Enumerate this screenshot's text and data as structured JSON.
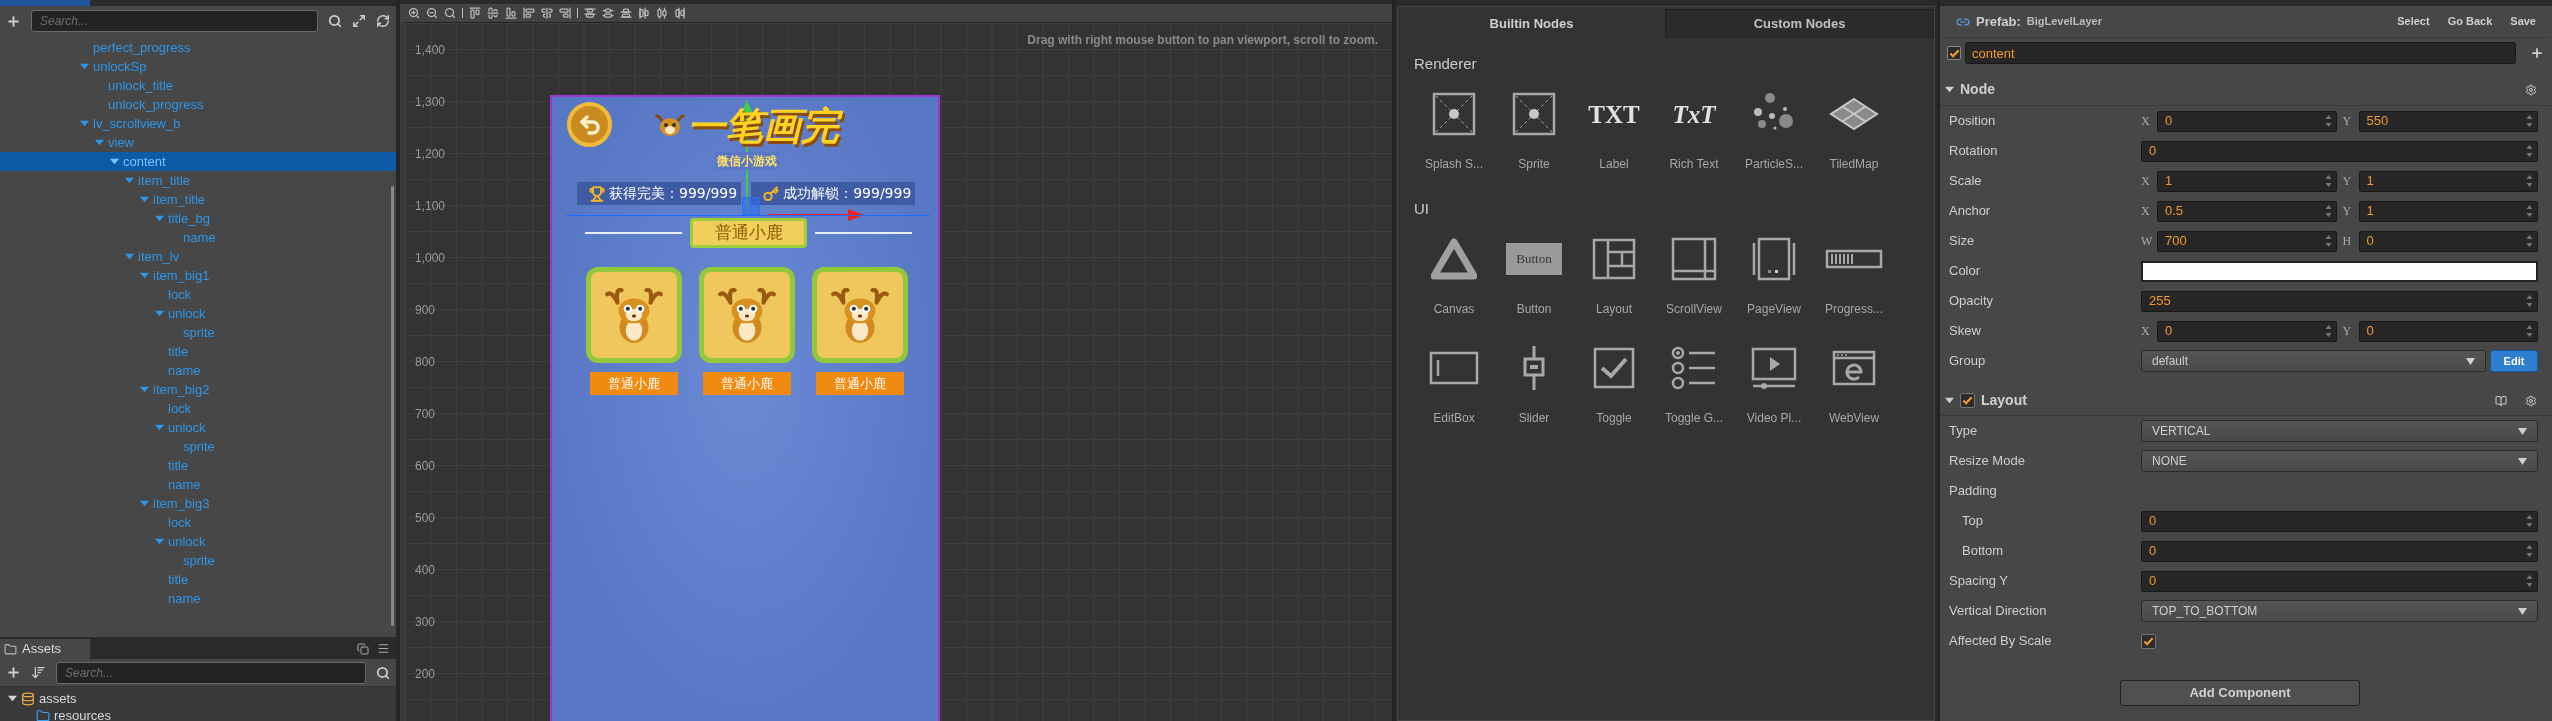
{
  "hierarchy": {
    "search": {
      "placeholder": "Search..."
    },
    "tree": [
      {
        "label": "perfect_progress",
        "selected": false
      },
      {
        "label": "unlockSp",
        "expanded": true,
        "selected": false,
        "children": [
          {
            "label": "unlock_title",
            "selected": false
          },
          {
            "label": "unlock_progress",
            "selected": false
          }
        ]
      },
      {
        "label": "lv_scrollview_b",
        "expanded": true,
        "selected": false,
        "children": [
          {
            "label": "view",
            "expanded": true,
            "selected": false,
            "children": [
              {
                "label": "content",
                "expanded": true,
                "selected": true,
                "children": [
                  {
                    "label": "item_title",
                    "expanded": true,
                    "selected": false,
                    "children": [
                      {
                        "label": "item_title",
                        "expanded": true,
                        "selected": false,
                        "children": [
                          {
                            "label": "title_bg",
                            "expanded": true,
                            "selected": false,
                            "children": [
                              {
                                "label": "name",
                                "selected": false
                              }
                            ]
                          }
                        ]
                      }
                    ]
                  },
                  {
                    "label": "item_lv",
                    "expanded": true,
                    "selected": false,
                    "children": [
                      {
                        "label": "item_big1",
                        "expanded": true,
                        "selected": false,
                        "children": [
                          {
                            "label": "lock",
                            "selected": false
                          },
                          {
                            "label": "unlock",
                            "expanded": true,
                            "selected": false,
                            "children": [
                              {
                                "label": "sprite",
                                "selected": false
                              }
                            ]
                          },
                          {
                            "label": "title",
                            "selected": false
                          },
                          {
                            "label": "name",
                            "selected": false
                          }
                        ]
                      },
                      {
                        "label": "item_big2",
                        "expanded": true,
                        "selected": false,
                        "children": [
                          {
                            "label": "lock",
                            "selected": false
                          },
                          {
                            "label": "unlock",
                            "expanded": true,
                            "selected": false,
                            "children": [
                              {
                                "label": "sprite",
                                "selected": false
                              }
                            ]
                          },
                          {
                            "label": "title",
                            "selected": false
                          },
                          {
                            "label": "name",
                            "selected": false
                          }
                        ]
                      },
                      {
                        "label": "item_big3",
                        "expanded": true,
                        "selected": false,
                        "children": [
                          {
                            "label": "lock",
                            "selected": false
                          },
                          {
                            "label": "unlock",
                            "expanded": true,
                            "selected": false,
                            "children": [
                              {
                                "label": "sprite",
                                "selected": false
                              }
                            ]
                          },
                          {
                            "label": "title",
                            "selected": false
                          },
                          {
                            "label": "name",
                            "selected": false
                          }
                        ]
                      }
                    ]
                  }
                ]
              }
            ]
          }
        ]
      }
    ]
  },
  "assets": {
    "title": "Assets",
    "search": {
      "placeholder": "Search..."
    },
    "tree": [
      {
        "label": "assets",
        "expanded": true,
        "children": [
          {
            "label": "resources"
          }
        ]
      }
    ]
  },
  "scene": {
    "hint": "Drag with right mouse button to pan viewport, scroll to zoom.",
    "ruler": [
      "1,400",
      "1,300",
      "1,200",
      "1,100",
      "1,000",
      "900",
      "800",
      "700",
      "600",
      "500",
      "400",
      "300",
      "200"
    ],
    "game": {
      "title": "一笔画完",
      "subtitle": "微信小游戏",
      "stats": [
        {
          "kind": "trophy",
          "text": "获得完美：999/999"
        },
        {
          "kind": "key",
          "text": "成功解锁：999/999"
        }
      ],
      "section_title": "普通小鹿",
      "cards": [
        {
          "label": "普通小鹿"
        },
        {
          "label": "普通小鹿"
        },
        {
          "label": "普通小鹿"
        }
      ]
    }
  },
  "node_library": {
    "tabs": [
      {
        "label": "Builtin Nodes",
        "selected": true
      },
      {
        "label": "Custom Nodes",
        "selected": false
      }
    ],
    "sections": [
      {
        "title": "Renderer",
        "items": [
          {
            "kind": "splash",
            "label": "Splash S..."
          },
          {
            "kind": "sprite",
            "label": "Sprite"
          },
          {
            "kind": "label",
            "label": "Label",
            "icon_text": "TXT"
          },
          {
            "kind": "richtext",
            "label": "Rich Text",
            "icon_text": "TxT"
          },
          {
            "kind": "particle",
            "label": "ParticleS..."
          },
          {
            "kind": "tiledmap",
            "label": "TiledMap"
          }
        ]
      },
      {
        "title": "UI",
        "items": [
          {
            "kind": "canvas",
            "label": "Canvas"
          },
          {
            "kind": "button",
            "label": "Button",
            "icon_text": "Button"
          },
          {
            "kind": "layout",
            "label": "Layout"
          },
          {
            "kind": "scrollview",
            "label": "ScrollView"
          },
          {
            "kind": "pageview",
            "label": "PageView"
          },
          {
            "kind": "progress",
            "label": "Progress..."
          },
          {
            "kind": "editbox",
            "label": "EditBox"
          },
          {
            "kind": "slider",
            "label": "Slider"
          },
          {
            "kind": "toggle",
            "label": "Toggle"
          },
          {
            "kind": "togglegroup",
            "label": "Toggle G..."
          },
          {
            "kind": "video",
            "label": "Video Pl..."
          },
          {
            "kind": "webview",
            "label": "WebView"
          }
        ]
      }
    ]
  },
  "inspector": {
    "prefab": {
      "label": "Prefab:",
      "name": "BigLevelLayer",
      "actions": [
        "Select",
        "Go Back",
        "Save"
      ]
    },
    "node_name": {
      "enabled": true,
      "value": "content"
    },
    "node_section": {
      "title": "Node",
      "expanded": true,
      "props": [
        {
          "kind": "vec2",
          "label": "Position",
          "fields": [
            {
              "axis": "X",
              "value": "0"
            },
            {
              "axis": "Y",
              "value": "550"
            }
          ]
        },
        {
          "kind": "number",
          "label": "Rotation",
          "value": "0"
        },
        {
          "kind": "vec2",
          "label": "Scale",
          "fields": [
            {
              "axis": "X",
              "value": "1"
            },
            {
              "axis": "Y",
              "value": "1"
            }
          ]
        },
        {
          "kind": "vec2",
          "label": "Anchor",
          "fields": [
            {
              "axis": "X",
              "value": "0.5"
            },
            {
              "axis": "Y",
              "value": "1"
            }
          ]
        },
        {
          "kind": "vec2",
          "label": "Size",
          "fields": [
            {
              "axis": "W",
              "value": "700"
            },
            {
              "axis": "H",
              "value": "0"
            }
          ]
        },
        {
          "kind": "color",
          "label": "Color",
          "color": "#ffffff"
        },
        {
          "kind": "number",
          "label": "Opacity",
          "value": "255"
        },
        {
          "kind": "vec2",
          "label": "Skew",
          "fields": [
            {
              "axis": "X",
              "value": "0"
            },
            {
              "axis": "Y",
              "value": "0"
            }
          ]
        },
        {
          "kind": "select",
          "label": "Group",
          "value": "default",
          "button": "Edit"
        }
      ]
    },
    "layout_section": {
      "title": "Layout",
      "expanded": true,
      "enabled": true,
      "props": [
        {
          "kind": "select",
          "label": "Type",
          "value": "VERTICAL"
        },
        {
          "kind": "select",
          "label": "Resize Mode",
          "value": "NONE"
        },
        {
          "kind": "group",
          "label": "Padding",
          "children": [
            {
              "kind": "number",
              "label": "Top",
              "value": "0"
            },
            {
              "kind": "number",
              "label": "Bottom",
              "value": "0"
            }
          ]
        },
        {
          "kind": "number",
          "label": "Spacing Y",
          "value": "0"
        },
        {
          "kind": "select",
          "label": "Vertical Direction",
          "value": "TOP_TO_BOTTOM"
        },
        {
          "kind": "checkbox",
          "label": "Affected By Scale",
          "checked": true
        }
      ]
    },
    "add_component": "Add Component"
  }
}
